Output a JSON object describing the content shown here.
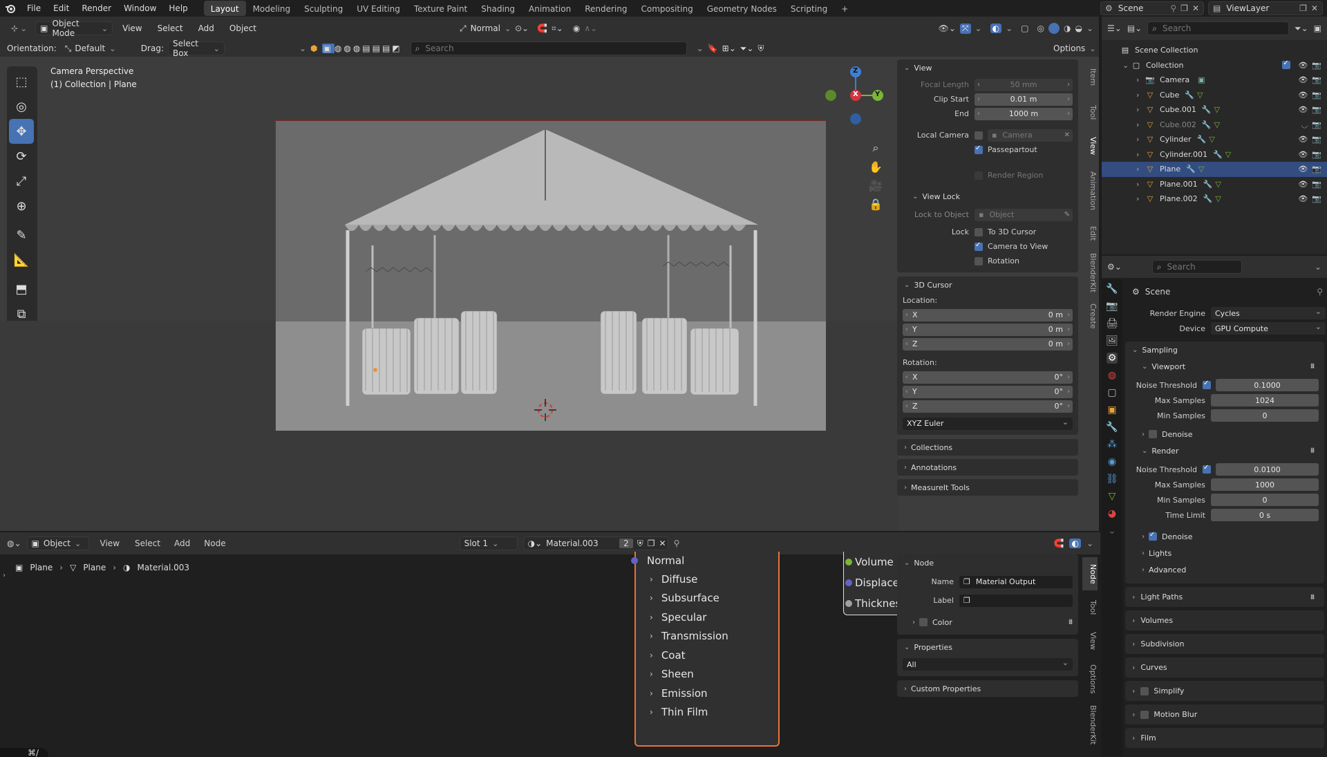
{
  "topbar": {
    "menus": [
      "File",
      "Edit",
      "Render",
      "Window",
      "Help"
    ],
    "workspaces": [
      "Layout",
      "Modeling",
      "Sculpting",
      "UV Editing",
      "Texture Paint",
      "Shading",
      "Animation",
      "Rendering",
      "Compositing",
      "Geometry Nodes",
      "Scripting"
    ],
    "active_workspace": "Layout",
    "add_tab": "+",
    "scene_name": "Scene",
    "view_layer": "ViewLayer"
  },
  "viewport": {
    "mode": "Object Mode",
    "menus": [
      "View",
      "Select",
      "Add",
      "Object"
    ],
    "orientation_label": "Orientation:",
    "orientation_value": "Default",
    "drag_label": "Drag:",
    "drag_value": "Select Box",
    "transform_pivot": "Normal",
    "search_placeholder": "Search",
    "options_label": "Options",
    "overlay_line1": "Camera Perspective",
    "overlay_line2": "(1) Collection | Plane",
    "gizmo": {
      "z": "Z",
      "x": "X",
      "y": "Y"
    }
  },
  "npanel": {
    "tabs": [
      "Item",
      "Tool",
      "View",
      "Animation",
      "Edit",
      "BlenderKit",
      "Create"
    ],
    "active_tab": "View",
    "view_header": "View",
    "focal_length_label": "Focal Length",
    "focal_length": "50 mm",
    "clip_start_label": "Clip Start",
    "clip_start": "0.01 m",
    "end_label": "End",
    "end": "1000 m",
    "local_camera_label": "Local Camera",
    "local_camera": "Camera",
    "passepartout": "Passepartout",
    "render_region": "Render Region",
    "view_lock_header": "View Lock",
    "lock_to_object_label": "Lock to Object",
    "lock_to_object": "Object",
    "lock_label": "Lock",
    "to_3d_cursor": "To 3D Cursor",
    "camera_to_view": "Camera to View",
    "rotation": "Rotation",
    "cursor_header": "3D Cursor",
    "location_label": "Location:",
    "loc_x_label": "X",
    "loc_x": "0 m",
    "loc_y_label": "Y",
    "loc_y": "0 m",
    "loc_z_label": "Z",
    "loc_z": "0 m",
    "rotation_label": "Rotation:",
    "rot_x_label": "X",
    "rot_x": "0°",
    "rot_y_label": "Y",
    "rot_y": "0°",
    "rot_z_label": "Z",
    "rot_z": "0°",
    "rotation_mode": "XYZ Euler",
    "collections": "Collections",
    "annotations": "Annotations",
    "measureit": "MeasureIt Tools"
  },
  "outliner": {
    "search_placeholder": "Search",
    "scene_collection": "Scene Collection",
    "collection": "Collection",
    "items": [
      {
        "name": "Camera",
        "dim": false
      },
      {
        "name": "Cube",
        "dim": false
      },
      {
        "name": "Cube.001",
        "dim": false
      },
      {
        "name": "Cube.002",
        "dim": true
      },
      {
        "name": "Cylinder",
        "dim": false
      },
      {
        "name": "Cylinder.001",
        "dim": false
      },
      {
        "name": "Plane",
        "dim": false
      },
      {
        "name": "Plane.001",
        "dim": false
      },
      {
        "name": "Plane.002",
        "dim": false
      }
    ]
  },
  "properties": {
    "search_placeholder": "Search",
    "context": "Scene",
    "render_engine_label": "Render Engine",
    "render_engine": "Cycles",
    "device_label": "Device",
    "device": "GPU Compute",
    "sampling": "Sampling",
    "viewport_header": "Viewport",
    "vp_noise_label": "Noise Threshold",
    "vp_noise": "0.1000",
    "vp_max_label": "Max Samples",
    "vp_max": "1024",
    "vp_min_label": "Min Samples",
    "vp_min": "0",
    "denoise": "Denoise",
    "render_header": "Render",
    "r_noise_label": "Noise Threshold",
    "r_noise": "0.0100",
    "r_max_label": "Max Samples",
    "r_max": "1000",
    "r_min_label": "Min Samples",
    "r_min": "0",
    "time_limit_label": "Time Limit",
    "time_limit": "0 s",
    "r_denoise": "Denoise",
    "lights": "Lights",
    "advanced": "Advanced",
    "sections": [
      "Light Paths",
      "Volumes",
      "Subdivision",
      "Curves",
      "Simplify",
      "Motion Blur",
      "Film"
    ]
  },
  "node_editor": {
    "mode": "Object",
    "menus": [
      "View",
      "Select",
      "Add",
      "Node"
    ],
    "slot": "Slot 1",
    "material": "Material.003",
    "users": "2",
    "breadcrumb": [
      "Plane",
      "Plane",
      "Material.003"
    ],
    "bsdf_socket": "Normal",
    "bsdf_panels": [
      "Diffuse",
      "Subsurface",
      "Specular",
      "Transmission",
      "Coat",
      "Sheen",
      "Emission",
      "Thin Film"
    ],
    "output_sockets": [
      "Volume",
      "Displacer",
      "Thicknes"
    ],
    "side_tabs": [
      "Node",
      "Tool",
      "View",
      "Options",
      "BlenderKit"
    ],
    "node_header": "Node",
    "name_label": "Name",
    "name_value": "Material Output",
    "label_label": "Label",
    "label_value": "",
    "color_label": "Color",
    "properties_header": "Properties",
    "properties_value": "All",
    "custom_properties": "Custom Properties"
  },
  "colors": {
    "accent": "#4772b3",
    "node_selected": "#e8733a",
    "gizmo_x": "#d4343e",
    "gizmo_y": "#7bb636",
    "gizmo_z": "#3d7fd6"
  }
}
